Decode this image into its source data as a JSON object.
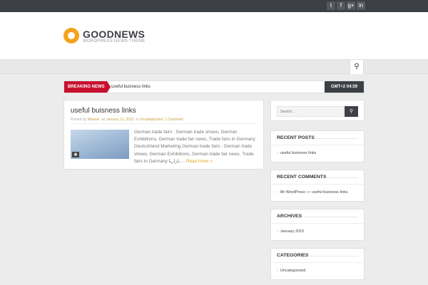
{
  "topbar": {
    "social_icons": [
      {
        "name": "twitter-icon",
        "glyph": "t"
      },
      {
        "name": "facebook-icon",
        "glyph": "f"
      },
      {
        "name": "google-plus-icon",
        "glyph": "g+"
      },
      {
        "name": "linkedin-icon",
        "glyph": "in"
      }
    ]
  },
  "brand": {
    "name": "GOODNEWS",
    "tagline": "WORDPRESS NEWS THEME",
    "accent": "#f5a31a"
  },
  "nav": {
    "search_icon": "search-icon"
  },
  "ticker": {
    "label": "BREAKING NEWS",
    "headline": "useful buisness links",
    "time": "GMT+2 04:59",
    "label_color": "#c8102e"
  },
  "post": {
    "title": "useful buisness links",
    "meta": {
      "posted_by_label": "Posted by",
      "author": "Mowsis",
      "date_prefix": "on",
      "date": "January 12, 2015",
      "category_prefix": "in",
      "category": "Uncategorized",
      "comments": "1 Comment"
    },
    "excerpt": "German trade fairs : German trade shows, German Exhibitions, German trade fair news, Trade fairs in Germany Deutschland Marketing German trade fairs : German trade shows, German Exhibitions, German trade fair news, Trade fairs in Germany بازاریا",
    "ellipsis": "...",
    "read_more": "Read more »"
  },
  "sidebar": {
    "search_placeholder": "Search ...",
    "recent_posts": {
      "title": "RECENT POSTS",
      "items": [
        "useful buisness links"
      ]
    },
    "recent_comments": {
      "title": "RECENT COMMENTS",
      "author": "Mr WordPress",
      "on": "on",
      "post": "useful buisness links"
    },
    "archives": {
      "title": "ARCHIVES",
      "items": [
        "January 2015"
      ]
    },
    "categories": {
      "title": "CATEGORIES",
      "items": [
        "Uncategorized"
      ]
    }
  }
}
